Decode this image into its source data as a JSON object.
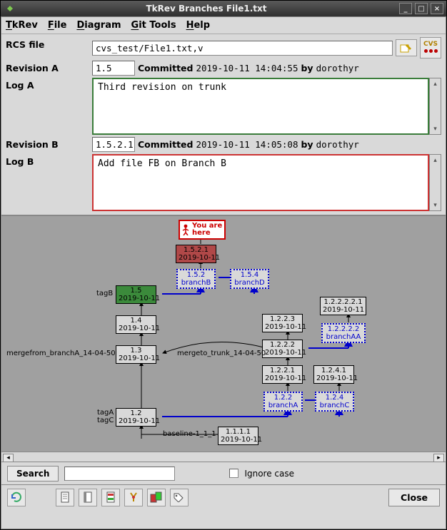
{
  "window": {
    "title": "TkRev Branches File1.txt"
  },
  "menu": {
    "tkrev": "TkRev",
    "file": "File",
    "diagram": "Diagram",
    "gittools": "Git Tools",
    "help": "Help"
  },
  "labels": {
    "rcsfile": "RCS file",
    "revA": "Revision A",
    "logA": "Log A",
    "revB": "Revision B",
    "logB": "Log B",
    "committed": "Committed",
    "by": "by"
  },
  "rcs_file": "cvs_test/File1.txt,v",
  "revA": {
    "rev": "1.5",
    "date": "2019-10-11 14:04:55",
    "author": "dorothyr",
    "log": "Third revision on trunk"
  },
  "revB": {
    "rev": "1.5.2.1",
    "date": "2019-10-11 14:05:08",
    "author": "dorothyr",
    "log": "Add file FB on Branch B"
  },
  "youarehere": "You are\nhere",
  "nodes": {
    "n_1521": {
      "rev": "1.5.2.1",
      "date": "2019-10-11"
    },
    "n_152": {
      "rev": "1.5.2",
      "label": "branchB"
    },
    "n_154": {
      "rev": "1.5.4",
      "label": "branchD"
    },
    "n_15": {
      "rev": "1.5",
      "date": "2019-10-11"
    },
    "n_14": {
      "rev": "1.4",
      "date": "2019-10-11"
    },
    "n_13": {
      "rev": "1.3",
      "date": "2019-10-11"
    },
    "n_12": {
      "rev": "1.2",
      "date": "2019-10-11"
    },
    "n_1111": {
      "rev": "1.1.1.1",
      "date": "2019-10-11"
    },
    "n_1223": {
      "rev": "1.2.2.3",
      "date": "2019-10-11"
    },
    "n_1222": {
      "rev": "1.2.2.2",
      "date": "2019-10-11"
    },
    "n_1221": {
      "rev": "1.2.2.1",
      "date": "2019-10-11"
    },
    "n_122": {
      "rev": "1.2.2",
      "label": "branchA"
    },
    "n_124": {
      "rev": "1.2.4",
      "label": "branchC"
    },
    "n_1241": {
      "rev": "1.2.4.1",
      "date": "2019-10-11"
    },
    "n_122221": {
      "rev": "1.2.2.2.2.1",
      "date": "2019-10-11"
    },
    "n_12222": {
      "rev": "1.2.2.2.2",
      "label": "branchAA"
    }
  },
  "tags": {
    "tagB": "tagB",
    "mergefrom": "mergefrom_branchA_14-04-50",
    "mergeto": "mergeto_trunk_14-04-50",
    "tagA": "tagA",
    "tagC": "tagC",
    "baseline": "baseline-1_1_1"
  },
  "search": {
    "button": "Search",
    "ignorecase": "Ignore case"
  },
  "close": "Close",
  "icons": {
    "cvs": "CVS"
  }
}
